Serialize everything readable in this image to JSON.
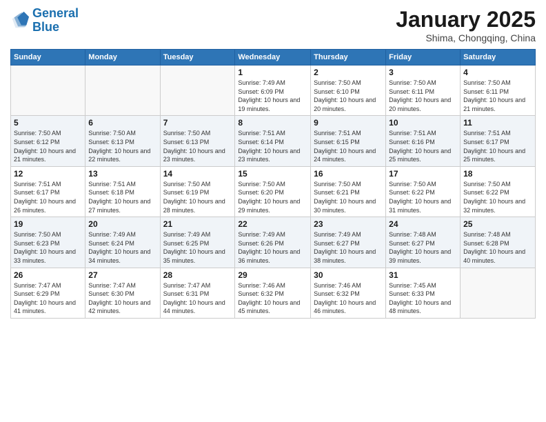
{
  "logo": {
    "line1": "General",
    "line2": "Blue"
  },
  "header": {
    "month": "January 2025",
    "location": "Shima, Chongqing, China"
  },
  "weekdays": [
    "Sunday",
    "Monday",
    "Tuesday",
    "Wednesday",
    "Thursday",
    "Friday",
    "Saturday"
  ],
  "weeks": [
    [
      {
        "day": "",
        "sunrise": "",
        "sunset": "",
        "daylight": ""
      },
      {
        "day": "",
        "sunrise": "",
        "sunset": "",
        "daylight": ""
      },
      {
        "day": "",
        "sunrise": "",
        "sunset": "",
        "daylight": ""
      },
      {
        "day": "1",
        "sunrise": "Sunrise: 7:49 AM",
        "sunset": "Sunset: 6:09 PM",
        "daylight": "Daylight: 10 hours and 19 minutes."
      },
      {
        "day": "2",
        "sunrise": "Sunrise: 7:50 AM",
        "sunset": "Sunset: 6:10 PM",
        "daylight": "Daylight: 10 hours and 20 minutes."
      },
      {
        "day": "3",
        "sunrise": "Sunrise: 7:50 AM",
        "sunset": "Sunset: 6:11 PM",
        "daylight": "Daylight: 10 hours and 20 minutes."
      },
      {
        "day": "4",
        "sunrise": "Sunrise: 7:50 AM",
        "sunset": "Sunset: 6:11 PM",
        "daylight": "Daylight: 10 hours and 21 minutes."
      }
    ],
    [
      {
        "day": "5",
        "sunrise": "Sunrise: 7:50 AM",
        "sunset": "Sunset: 6:12 PM",
        "daylight": "Daylight: 10 hours and 21 minutes."
      },
      {
        "day": "6",
        "sunrise": "Sunrise: 7:50 AM",
        "sunset": "Sunset: 6:13 PM",
        "daylight": "Daylight: 10 hours and 22 minutes."
      },
      {
        "day": "7",
        "sunrise": "Sunrise: 7:50 AM",
        "sunset": "Sunset: 6:13 PM",
        "daylight": "Daylight: 10 hours and 23 minutes."
      },
      {
        "day": "8",
        "sunrise": "Sunrise: 7:51 AM",
        "sunset": "Sunset: 6:14 PM",
        "daylight": "Daylight: 10 hours and 23 minutes."
      },
      {
        "day": "9",
        "sunrise": "Sunrise: 7:51 AM",
        "sunset": "Sunset: 6:15 PM",
        "daylight": "Daylight: 10 hours and 24 minutes."
      },
      {
        "day": "10",
        "sunrise": "Sunrise: 7:51 AM",
        "sunset": "Sunset: 6:16 PM",
        "daylight": "Daylight: 10 hours and 25 minutes."
      },
      {
        "day": "11",
        "sunrise": "Sunrise: 7:51 AM",
        "sunset": "Sunset: 6:17 PM",
        "daylight": "Daylight: 10 hours and 25 minutes."
      }
    ],
    [
      {
        "day": "12",
        "sunrise": "Sunrise: 7:51 AM",
        "sunset": "Sunset: 6:17 PM",
        "daylight": "Daylight: 10 hours and 26 minutes."
      },
      {
        "day": "13",
        "sunrise": "Sunrise: 7:51 AM",
        "sunset": "Sunset: 6:18 PM",
        "daylight": "Daylight: 10 hours and 27 minutes."
      },
      {
        "day": "14",
        "sunrise": "Sunrise: 7:50 AM",
        "sunset": "Sunset: 6:19 PM",
        "daylight": "Daylight: 10 hours and 28 minutes."
      },
      {
        "day": "15",
        "sunrise": "Sunrise: 7:50 AM",
        "sunset": "Sunset: 6:20 PM",
        "daylight": "Daylight: 10 hours and 29 minutes."
      },
      {
        "day": "16",
        "sunrise": "Sunrise: 7:50 AM",
        "sunset": "Sunset: 6:21 PM",
        "daylight": "Daylight: 10 hours and 30 minutes."
      },
      {
        "day": "17",
        "sunrise": "Sunrise: 7:50 AM",
        "sunset": "Sunset: 6:22 PM",
        "daylight": "Daylight: 10 hours and 31 minutes."
      },
      {
        "day": "18",
        "sunrise": "Sunrise: 7:50 AM",
        "sunset": "Sunset: 6:22 PM",
        "daylight": "Daylight: 10 hours and 32 minutes."
      }
    ],
    [
      {
        "day": "19",
        "sunrise": "Sunrise: 7:50 AM",
        "sunset": "Sunset: 6:23 PM",
        "daylight": "Daylight: 10 hours and 33 minutes."
      },
      {
        "day": "20",
        "sunrise": "Sunrise: 7:49 AM",
        "sunset": "Sunset: 6:24 PM",
        "daylight": "Daylight: 10 hours and 34 minutes."
      },
      {
        "day": "21",
        "sunrise": "Sunrise: 7:49 AM",
        "sunset": "Sunset: 6:25 PM",
        "daylight": "Daylight: 10 hours and 35 minutes."
      },
      {
        "day": "22",
        "sunrise": "Sunrise: 7:49 AM",
        "sunset": "Sunset: 6:26 PM",
        "daylight": "Daylight: 10 hours and 36 minutes."
      },
      {
        "day": "23",
        "sunrise": "Sunrise: 7:49 AM",
        "sunset": "Sunset: 6:27 PM",
        "daylight": "Daylight: 10 hours and 38 minutes."
      },
      {
        "day": "24",
        "sunrise": "Sunrise: 7:48 AM",
        "sunset": "Sunset: 6:27 PM",
        "daylight": "Daylight: 10 hours and 39 minutes."
      },
      {
        "day": "25",
        "sunrise": "Sunrise: 7:48 AM",
        "sunset": "Sunset: 6:28 PM",
        "daylight": "Daylight: 10 hours and 40 minutes."
      }
    ],
    [
      {
        "day": "26",
        "sunrise": "Sunrise: 7:47 AM",
        "sunset": "Sunset: 6:29 PM",
        "daylight": "Daylight: 10 hours and 41 minutes."
      },
      {
        "day": "27",
        "sunrise": "Sunrise: 7:47 AM",
        "sunset": "Sunset: 6:30 PM",
        "daylight": "Daylight: 10 hours and 42 minutes."
      },
      {
        "day": "28",
        "sunrise": "Sunrise: 7:47 AM",
        "sunset": "Sunset: 6:31 PM",
        "daylight": "Daylight: 10 hours and 44 minutes."
      },
      {
        "day": "29",
        "sunrise": "Sunrise: 7:46 AM",
        "sunset": "Sunset: 6:32 PM",
        "daylight": "Daylight: 10 hours and 45 minutes."
      },
      {
        "day": "30",
        "sunrise": "Sunrise: 7:46 AM",
        "sunset": "Sunset: 6:32 PM",
        "daylight": "Daylight: 10 hours and 46 minutes."
      },
      {
        "day": "31",
        "sunrise": "Sunrise: 7:45 AM",
        "sunset": "Sunset: 6:33 PM",
        "daylight": "Daylight: 10 hours and 48 minutes."
      },
      {
        "day": "",
        "sunrise": "",
        "sunset": "",
        "daylight": ""
      }
    ]
  ]
}
